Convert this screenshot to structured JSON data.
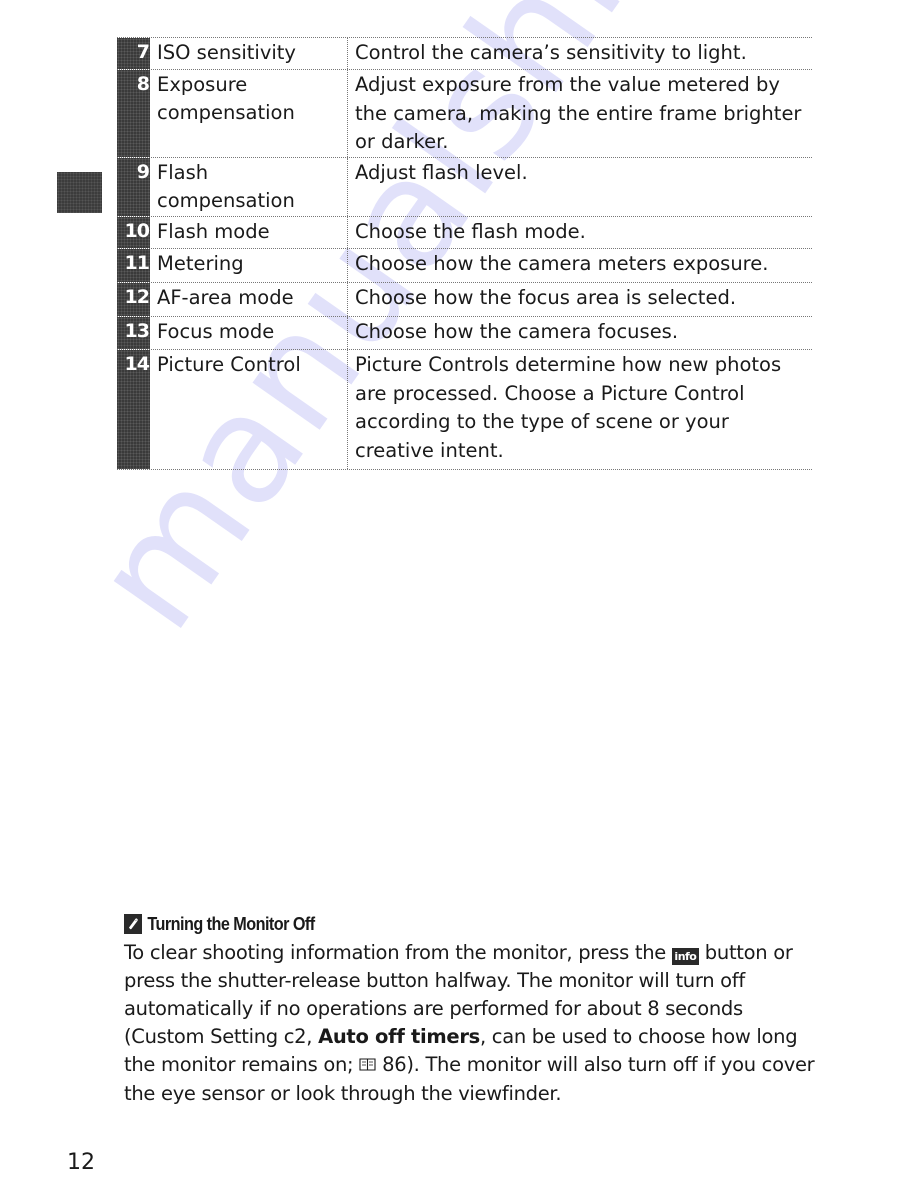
{
  "watermark": "manualshive.com",
  "table": {
    "rows": [
      {
        "number": "7",
        "label": "ISO sensitivity",
        "description": "Control the camera’s sensitivity to light."
      },
      {
        "number": "8",
        "label": "Exposure compensation",
        "description": "Adjust exposure from the value metered by the camera, making the entire frame brighter or darker."
      },
      {
        "number": "9",
        "label": "Flash compensation",
        "description": "Adjust flash level."
      },
      {
        "number": "10",
        "label": "Flash mode",
        "description": "Choose the flash mode."
      },
      {
        "number": "11",
        "label": "Metering",
        "description": "Choose how the camera meters exposure."
      },
      {
        "number": "12",
        "label": "AF-area mode",
        "description": "Choose how the focus area is selected."
      },
      {
        "number": "13",
        "label": "Focus mode",
        "description": "Choose how the camera focuses."
      },
      {
        "number": "14",
        "label": "Picture Control",
        "description": "Picture Controls determine how new photos are processed.  Choose a Picture Control according to the type of scene or your creative intent."
      }
    ]
  },
  "note": {
    "icon": "pencil-note-icon",
    "title": "Turning the Monitor Off",
    "body": {
      "part1": "To clear shooting information from the monitor, press the ",
      "info_button_label": "info",
      "part2": " button or press the shutter-release button halfway.  The monitor will turn off automatically if no operations are performed for about 8 seconds (Custom Setting c2, ",
      "bold_setting": "Auto off timers",
      "part3": ", can be used to choose how long the monitor remains on; ",
      "page_ref": "86",
      "part4": ").  The monitor will also turn off if you cover the eye sensor or look through the viewfinder."
    }
  },
  "page_number": "12"
}
